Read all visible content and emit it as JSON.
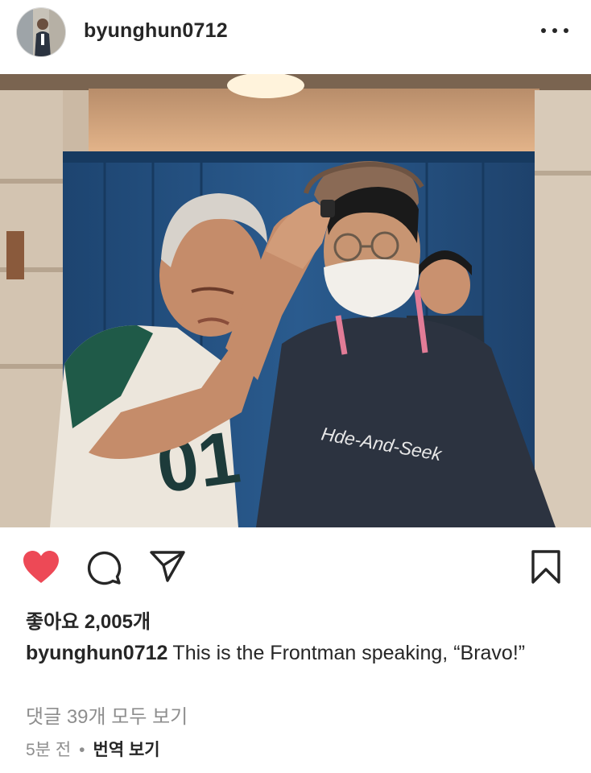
{
  "post": {
    "username": "byunghun0712",
    "likes_text": "좋아요 2,005개",
    "caption_user": "byunghun0712",
    "caption_text": "This is the Frontman speaking, “Bravo!”",
    "view_comments": "댓글 39개 모두 보기",
    "time": "5분 전",
    "separator": "•",
    "translate": "번역 보기"
  },
  "photo": {
    "shirt_text": "Hde-And-Seek",
    "jersey_number": "01"
  },
  "icons": {
    "more": "more-icon",
    "like": "heart-icon",
    "comment": "comment-icon",
    "share": "share-icon",
    "save": "bookmark-icon"
  },
  "colors": {
    "like_active": "#ed4956",
    "text_primary": "#262626",
    "text_secondary": "#8e8e8e"
  }
}
